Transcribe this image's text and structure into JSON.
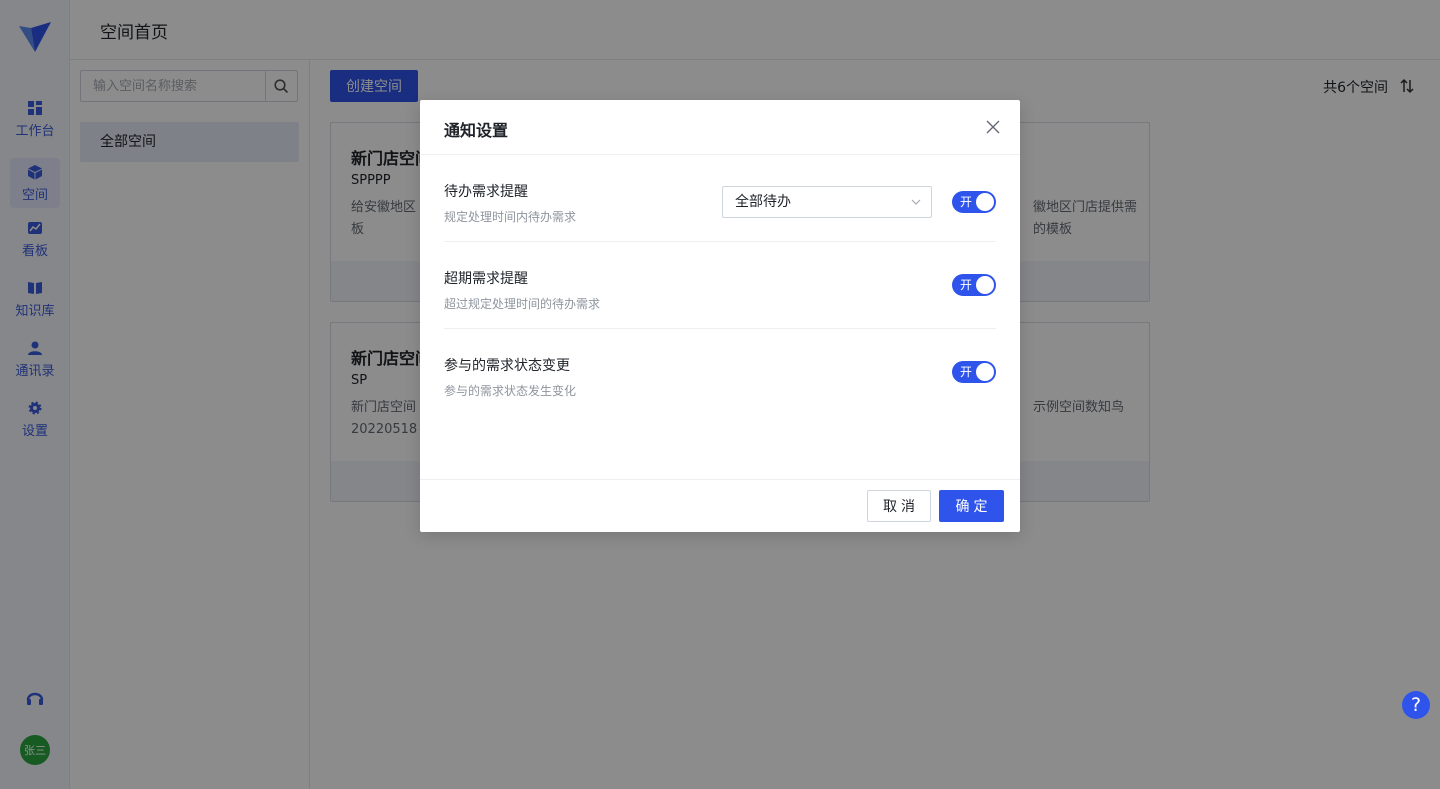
{
  "nav": {
    "items": [
      {
        "label": "工作台",
        "icon": "dashboard-icon"
      },
      {
        "label": "空间",
        "icon": "cube-icon"
      },
      {
        "label": "看板",
        "icon": "chart-icon"
      },
      {
        "label": "知识库",
        "icon": "book-icon"
      },
      {
        "label": "通讯录",
        "icon": "user-icon"
      },
      {
        "label": "设置",
        "icon": "gear-icon"
      }
    ],
    "active": "空间",
    "avatar_text": "张三"
  },
  "header": {
    "title": "空间首页"
  },
  "sidebar": {
    "search_placeholder": "输入空间名称搜索",
    "all_spaces_label": "全部空间"
  },
  "main": {
    "create_button": "创建空间",
    "count_text": "共6个空间",
    "cards": [
      {
        "title": "新门店空间",
        "code": "SPPPP",
        "desc": "给安徽地区",
        "desc2": "板"
      },
      {
        "title": "",
        "code": "",
        "desc": "徽地区门店提供需",
        "desc2": "的模板"
      },
      {
        "title": "新门店空间",
        "code": "SP",
        "desc": "新门店空间",
        "desc2": "20220518"
      },
      {
        "title": "",
        "code": "",
        "desc": "示例空间数知鸟",
        "desc2": ""
      }
    ]
  },
  "modal": {
    "title": "通知设置",
    "rows": [
      {
        "label": "待办需求提醒",
        "sub": "规定处理时间内待办需求",
        "select_value": "全部待办",
        "toggle_label": "开"
      },
      {
        "label": "超期需求提醒",
        "sub": "超过规定处理时间的待办需求",
        "toggle_label": "开"
      },
      {
        "label": "参与的需求状态变更",
        "sub": "参与的需求状态发生变化",
        "toggle_label": "开"
      }
    ],
    "cancel_label": "取消",
    "ok_label": "确定"
  },
  "colors": {
    "accent": "#2f54eb",
    "overlay": "rgba(0,0,0,0.45)"
  }
}
